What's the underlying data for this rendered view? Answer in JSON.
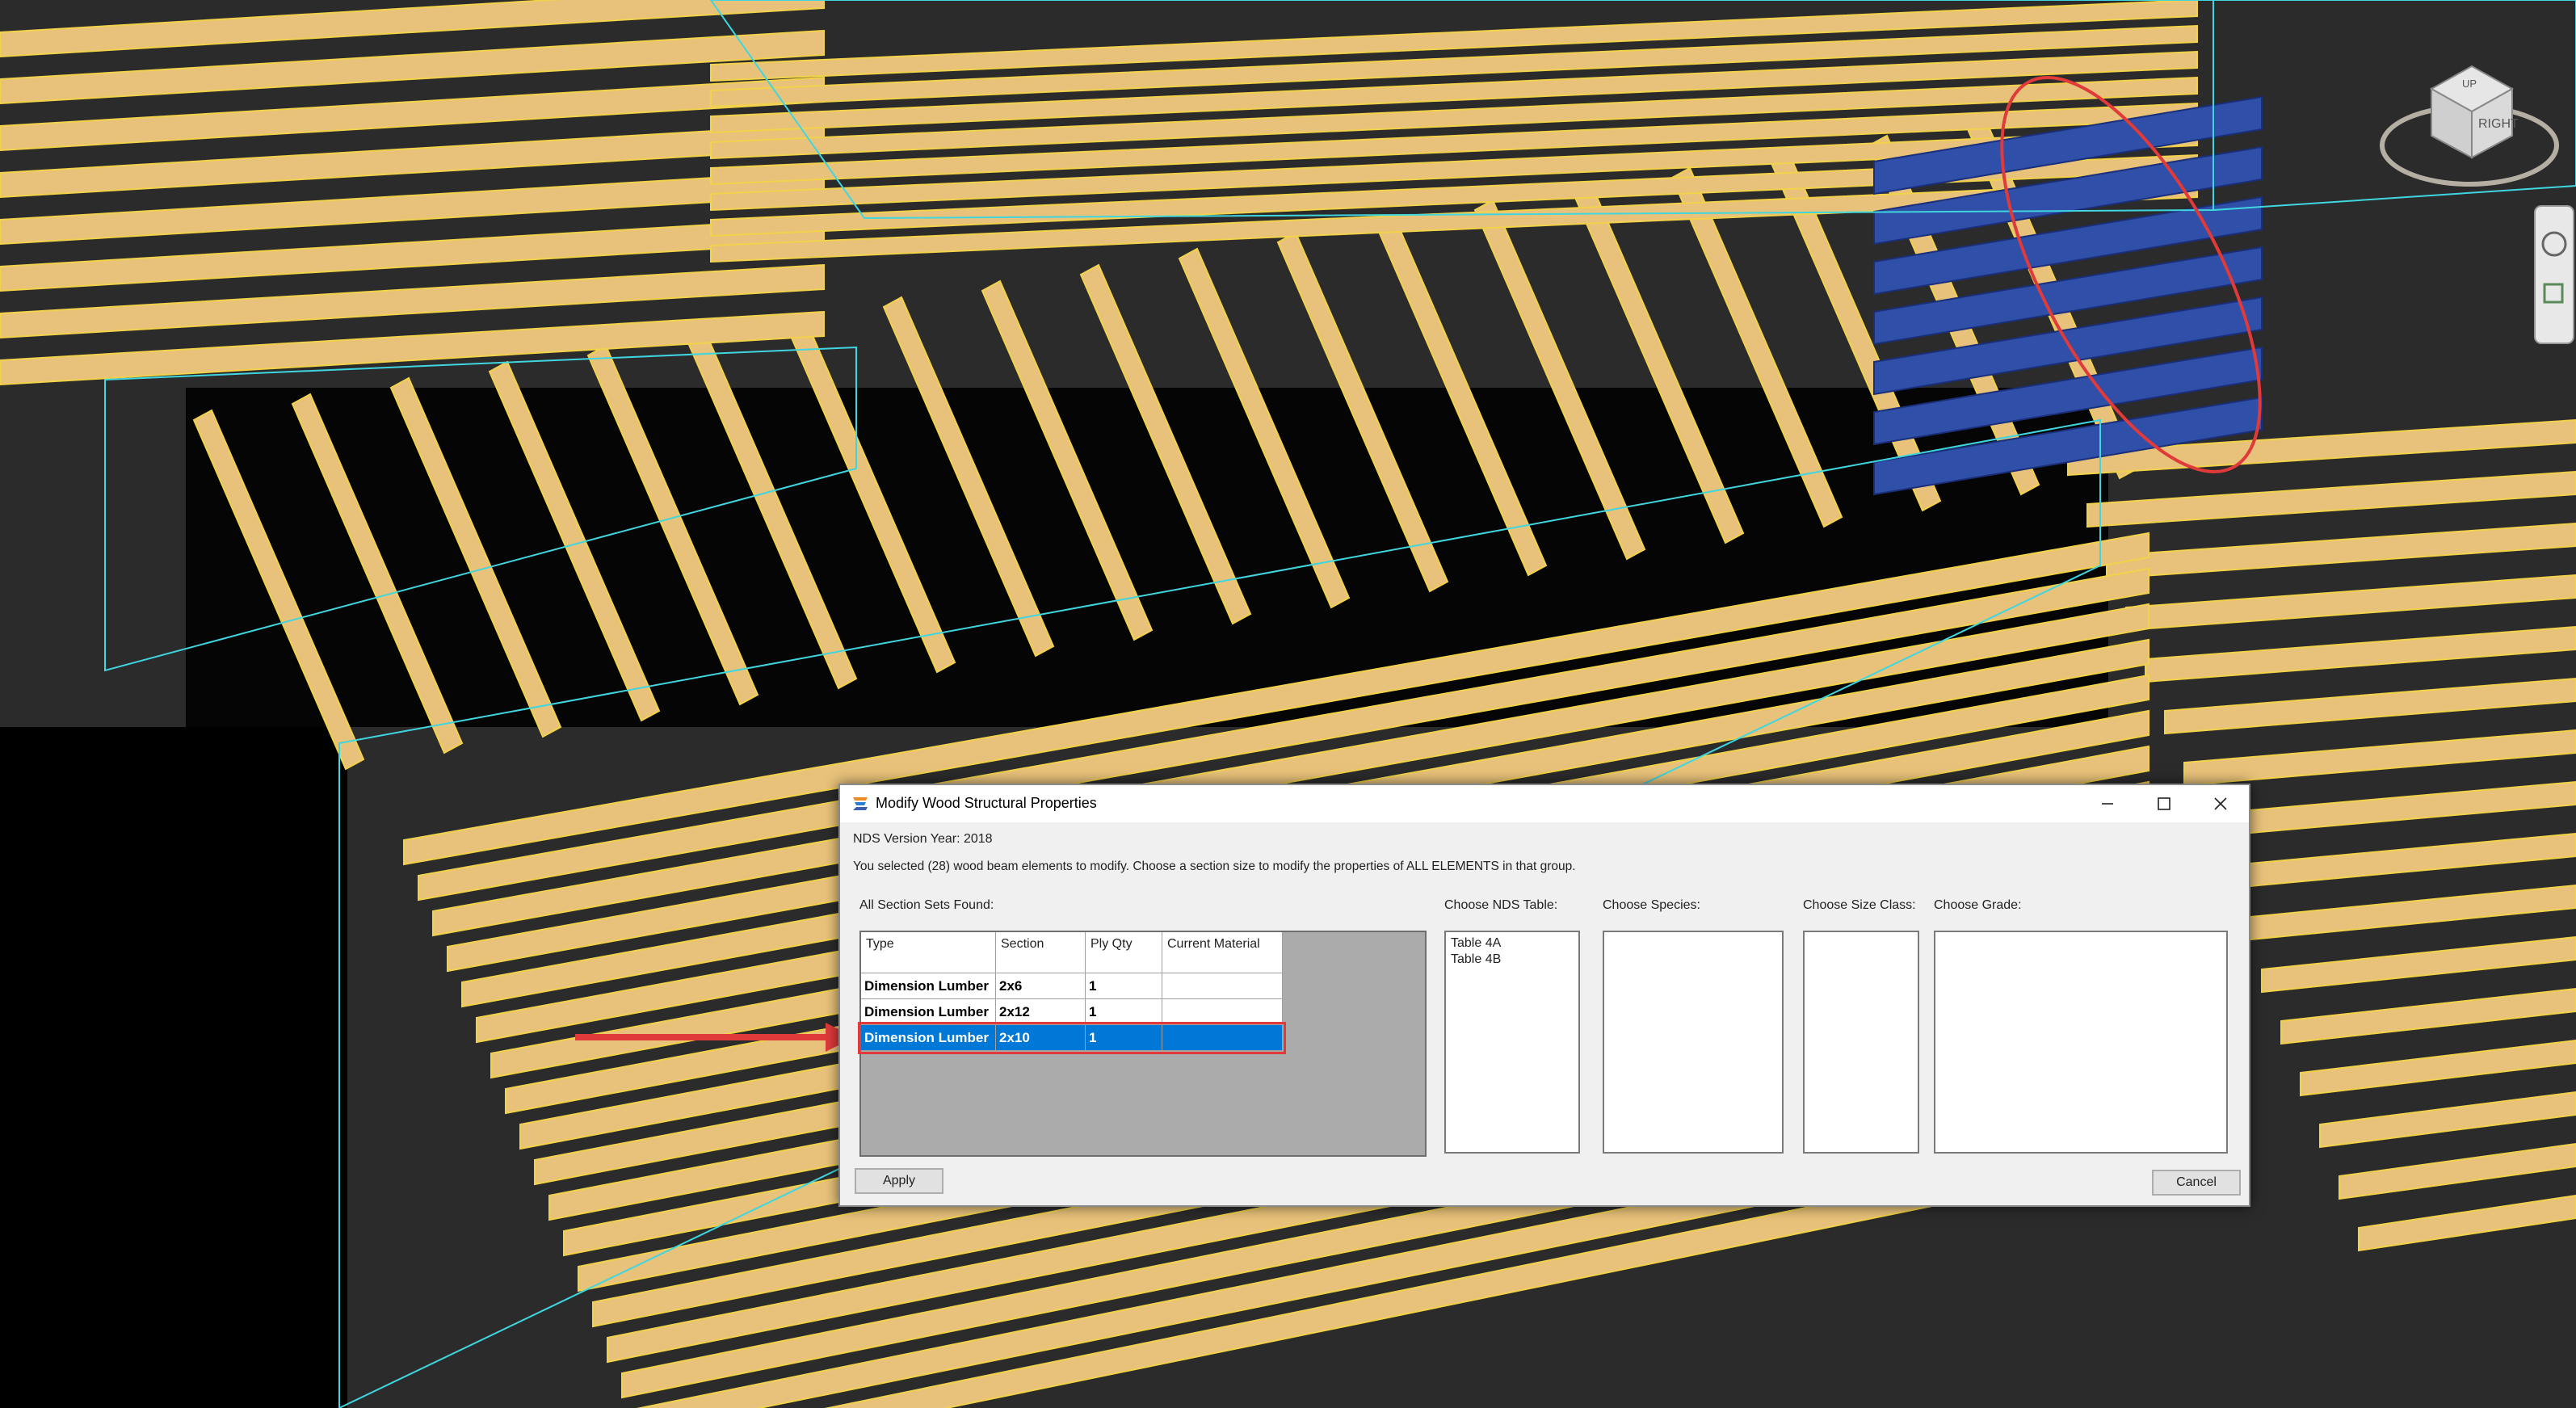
{
  "dialog": {
    "title": "Modify Wood Structural Properties",
    "nds_version": "NDS Version Year: 2018",
    "instruction": "You selected (28) wood beam elements to modify. Choose a section size to modify the properties of ALL ELEMENTS in that group.",
    "section_sets_label": "All Section Sets Found:",
    "columns": [
      "Type",
      "Section",
      "Ply Qty",
      "Current Material"
    ],
    "rows": [
      {
        "type": "Dimension Lumber",
        "section": "2x6",
        "ply_qty": "1",
        "material": ""
      },
      {
        "type": "Dimension Lumber",
        "section": "2x12",
        "ply_qty": "1",
        "material": ""
      },
      {
        "type": "Dimension Lumber",
        "section": "2x10",
        "ply_qty": "1",
        "material": "",
        "selected": true
      }
    ],
    "nds_table_label": "Choose NDS Table:",
    "nds_table_options": [
      "Table 4A",
      "Table 4B"
    ],
    "species_label": "Choose Species:",
    "size_class_label": "Choose Size Class:",
    "grade_label": "Choose Grade:",
    "apply_label": "Apply",
    "cancel_label": "Cancel"
  },
  "viewcube": {
    "face_label": "RIGHT",
    "top_label": "UP"
  },
  "colors": {
    "joist": "#e8c27a",
    "joist_edge": "#f2d24a",
    "selected_joist": "#2f4fa8",
    "outline": "#3fd6e0",
    "background": "#2b2b2b",
    "selection_blue": "#0078d7",
    "annotation_red": "#e03a3a"
  }
}
